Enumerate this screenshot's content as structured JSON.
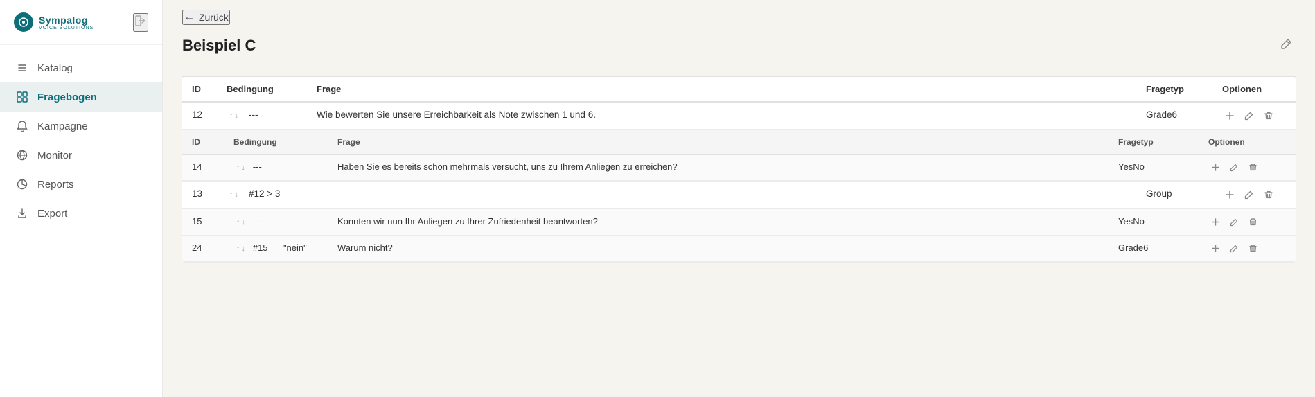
{
  "sidebar": {
    "logo": {
      "title": "Sympalog",
      "subtitle": "VOICE SOLUTIONS"
    },
    "logout_icon": "→",
    "items": [
      {
        "id": "katalog",
        "label": "Katalog",
        "icon": "list",
        "active": false
      },
      {
        "id": "fragebogen",
        "label": "Fragebogen",
        "icon": "grid",
        "active": true
      },
      {
        "id": "kampagne",
        "label": "Kampagne",
        "icon": "bell",
        "active": false
      },
      {
        "id": "monitor",
        "label": "Monitor",
        "icon": "chart",
        "active": false
      },
      {
        "id": "reports",
        "label": "Reports",
        "icon": "report",
        "active": false
      },
      {
        "id": "export",
        "label": "Export",
        "icon": "export",
        "active": false
      }
    ]
  },
  "topbar": {
    "back_label": "Zurück"
  },
  "page": {
    "title": "Beispiel C",
    "edit_icon": "✎"
  },
  "table": {
    "headers": {
      "id": "ID",
      "condition": "Bedingung",
      "question": "Frage",
      "type": "Fragetyp",
      "options": "Optionen"
    },
    "rows": [
      {
        "id": "12",
        "condition": "---",
        "question": "Wie bewerten Sie unsere Erreichbarkeit als Note zwischen 1 und 6.",
        "type": "Grade6",
        "sub_rows": []
      },
      {
        "id": "13",
        "condition": "#12 > 3",
        "question": "",
        "type": "Group",
        "sub_rows": [
          {
            "id": "14",
            "condition": "---",
            "question": "Haben Sie es bereits schon mehrmals versucht, uns zu Ihrem Anliegen zu erreichen?",
            "type": "YesNo"
          },
          {
            "id": "15",
            "condition": "---",
            "question": "Konnten wir nun Ihr Anliegen zu Ihrer Zufriedenheit beantworten?",
            "type": "YesNo"
          },
          {
            "id": "24",
            "condition": "#15 == \"nein\"",
            "question": "Warum nicht?",
            "type": "Grade6"
          }
        ]
      }
    ]
  }
}
